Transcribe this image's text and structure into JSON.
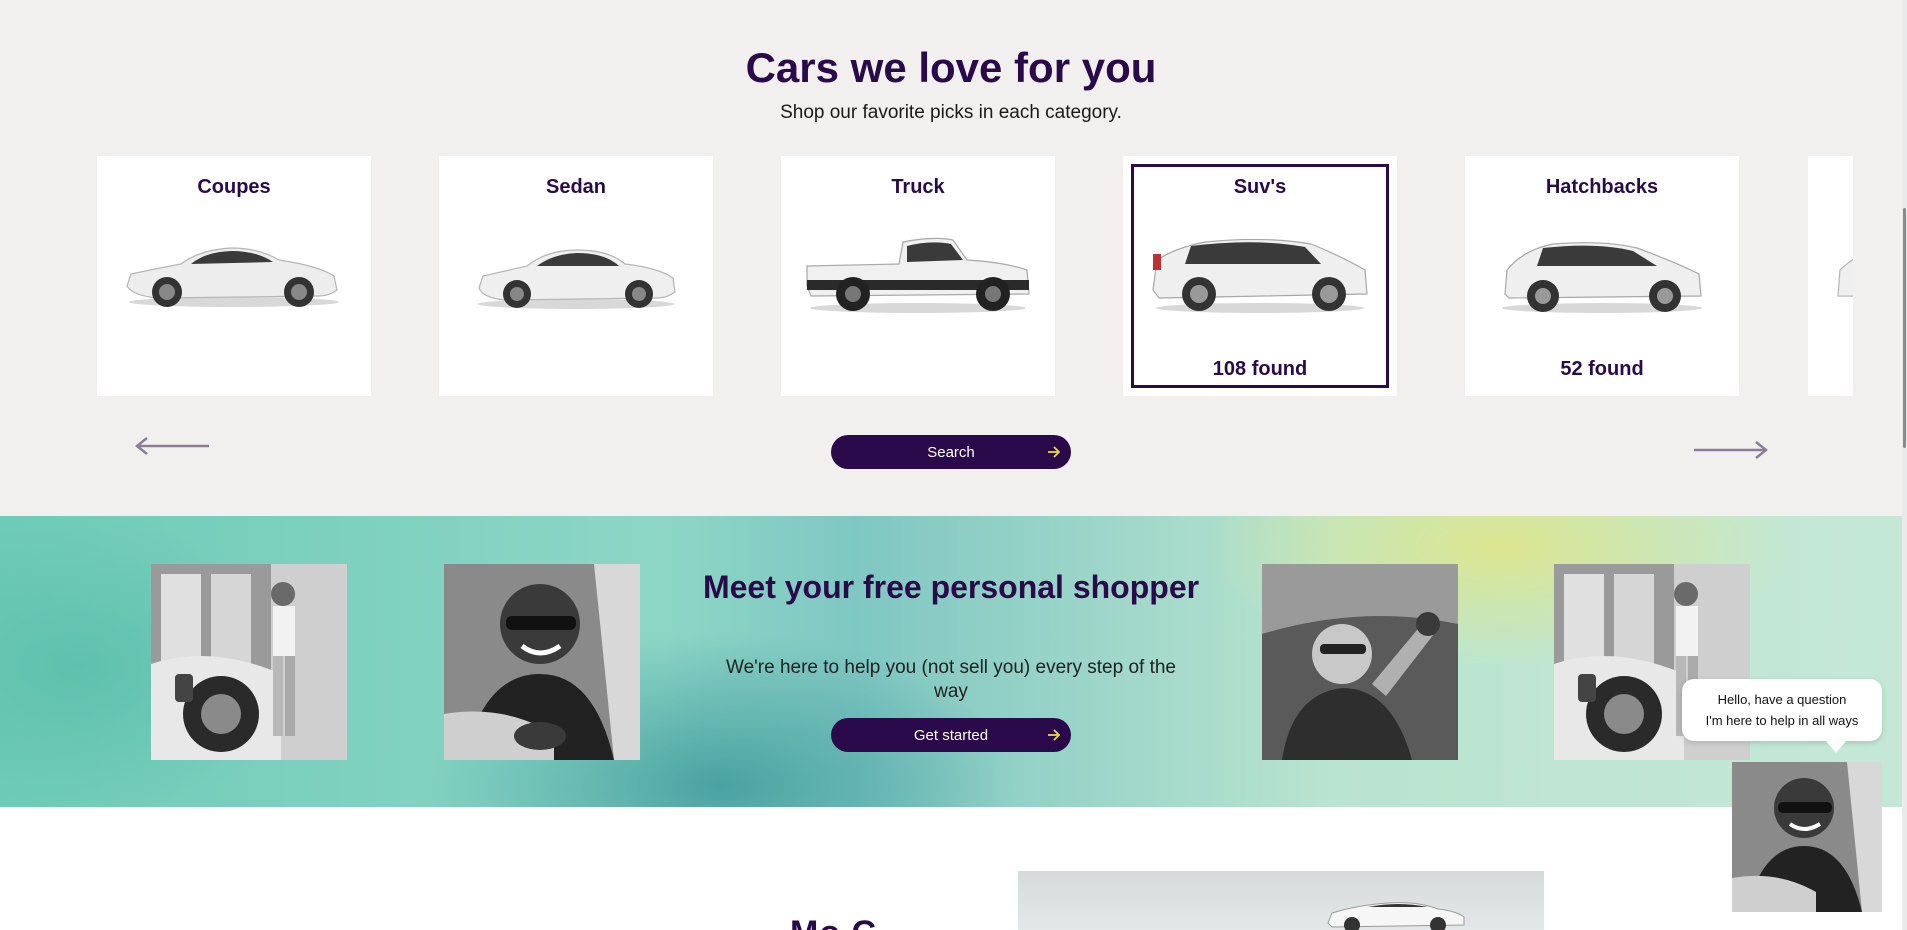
{
  "categories_section": {
    "title": "Cars we love for you",
    "subtitle": "Shop our favorite picks in each category.",
    "cards": [
      {
        "label": "Coupes",
        "count": "",
        "icon": "coupe-car-image"
      },
      {
        "label": "Sedan",
        "count": "",
        "icon": "sedan-car-image"
      },
      {
        "label": "Truck",
        "count": "",
        "icon": "pickup-truck-image"
      },
      {
        "label": "Suv's",
        "count": "108 found",
        "icon": "suv-car-image",
        "selected": true
      },
      {
        "label": "Hatchbacks",
        "count": "52 found",
        "icon": "hatchback-car-image"
      },
      {
        "label": "",
        "count": "",
        "icon": "partial-car-image"
      }
    ],
    "search_label": "Search",
    "prev_icon": "arrow-left-icon",
    "next_icon": "arrow-right-icon"
  },
  "shopper_section": {
    "title": "Meet your free personal shopper",
    "subtitle": "We're here to help you (not sell you) every step of the way",
    "cta_label": "Get started",
    "photos": [
      "woman-charging-ev-photo",
      "smiling-man-in-car-photo",
      "mechanic-under-car-photo",
      "woman-charging-ev-photo"
    ]
  },
  "chat": {
    "line1": "Hello, have a question",
    "line2": "I'm here to help in all ways"
  },
  "lower_section": {
    "heading_partial": "Mo  C"
  },
  "colors": {
    "brand": "#2a0a4a",
    "page_bg": "#f2f0ee",
    "arrow_accent": "#e6d84a"
  }
}
